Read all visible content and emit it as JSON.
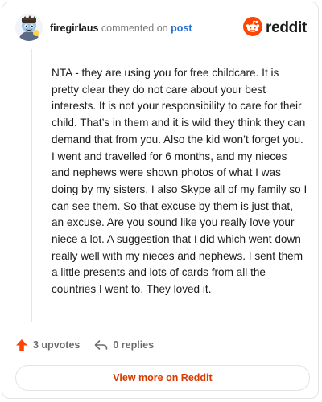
{
  "header": {
    "username": "firegirlaus",
    "commented_on": "commented on",
    "post_link": "post",
    "avatar_icon": "snoo-avatar-icon",
    "brand_icon": "reddit-logo-icon",
    "brand_name": "reddit"
  },
  "comment": {
    "body": "NTA - they are using you for free childcare. It is pretty clear they do not care about your best interests. It is not your responsibility to care for their child. That’s in them and it is wild they think they can demand that from you. Also the kid won’t forget you. I went and travelled for 6 months, and my nieces and nephews were shown photos of what I was doing by my sisters. I also Skype all of my family so I can see them. So that excuse by them is just that, an excuse. Are you sound like you really love your niece a lot. A suggestion that I did which went down really well with my nieces and nephews. I sent them a little presents and lots of cards from all the countries I went to. They loved it."
  },
  "actions": {
    "upvotes_label": "3 upvotes",
    "replies_label": "0 replies",
    "upvote_icon": "upvote-arrow-icon",
    "reply_icon": "reply-arrow-icon"
  },
  "footer": {
    "view_more_label": "View more on Reddit"
  },
  "colors": {
    "brand_orange": "#ff4500",
    "link_blue": "#2a6fd6",
    "button_text": "#d93a00",
    "muted_text": "#7c7c7c"
  }
}
